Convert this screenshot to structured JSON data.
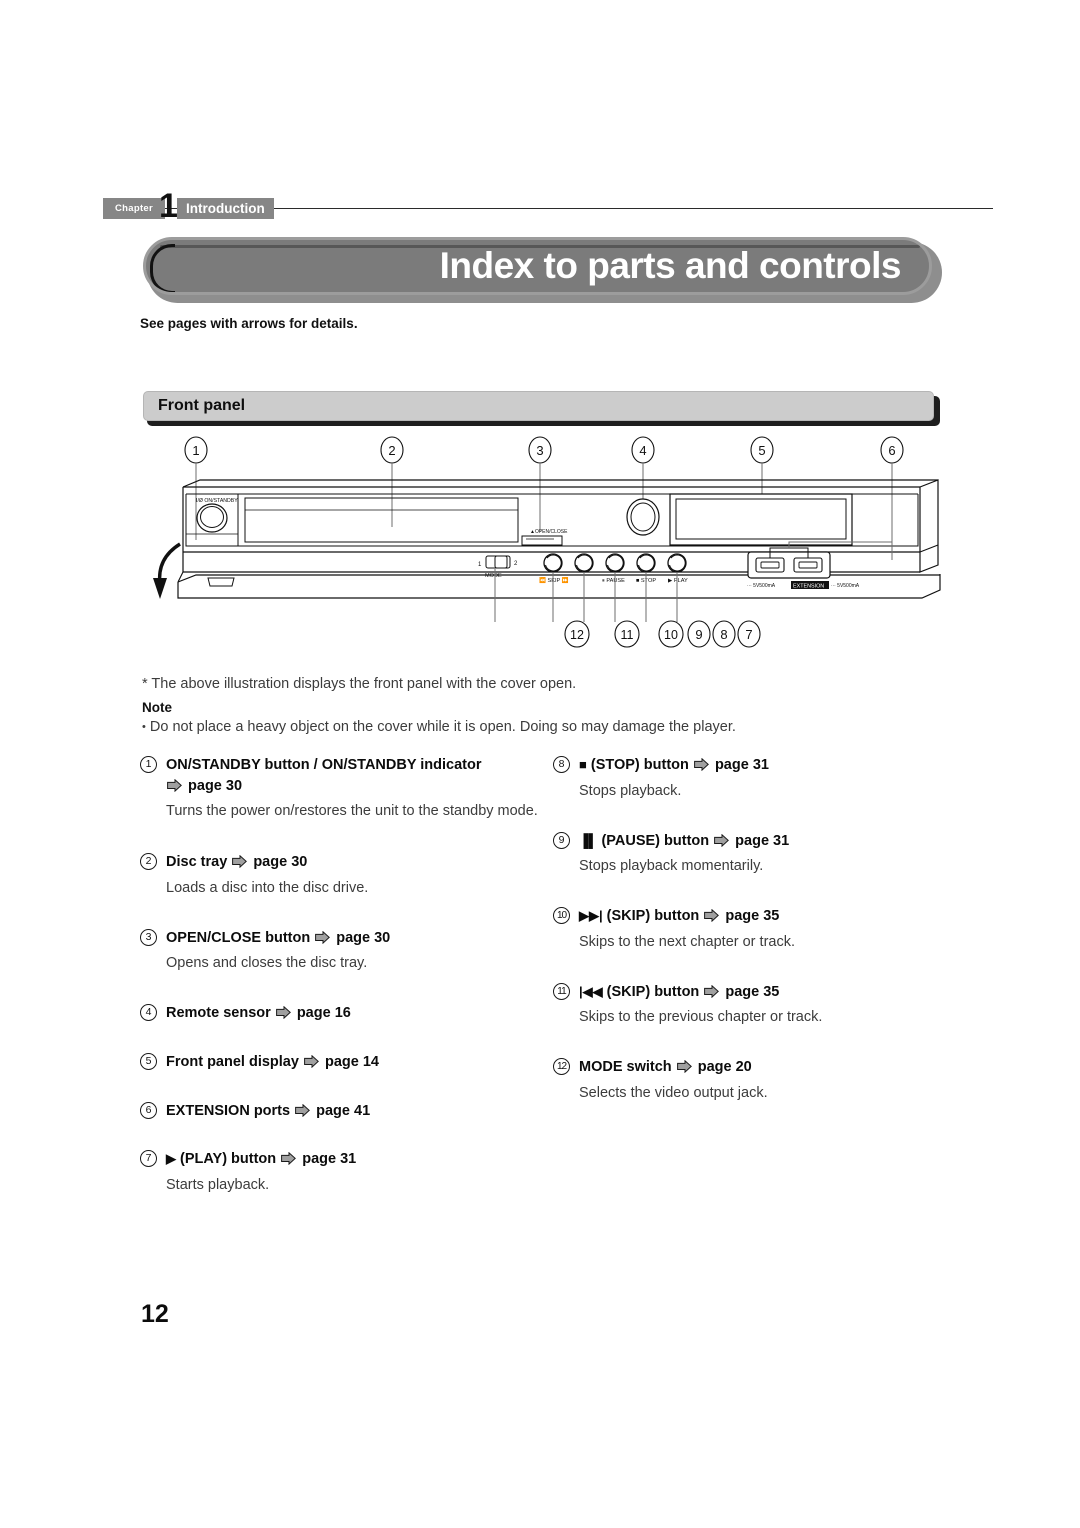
{
  "chapter": {
    "label": "Chapter",
    "number": "1",
    "title": "Introduction"
  },
  "page_title": "Index to parts and controls",
  "intro_line": "See pages with arrows for details.",
  "section": {
    "heading": "Front panel"
  },
  "illustration": {
    "callouts_top": [
      "1",
      "2",
      "3",
      "4",
      "5",
      "6"
    ],
    "callouts_bottom": [
      "12",
      "11",
      "10",
      "9",
      "8",
      "7"
    ],
    "panel_labels": {
      "standby": "I/Ø ON/STANDBY",
      "open_close": "OPEN/CLOSE",
      "mode": "MODE",
      "mode_pos_left": "1",
      "mode_pos_right": "2",
      "skip_prev": "◀◀",
      "skip_label": "SKIP",
      "skip_next": "▶▶",
      "pause": "PAUSE",
      "stop": "STOP",
      "play": "PLAY",
      "extension": "EXTENSION",
      "port_rating_left": "5V500mA",
      "port_rating_right": "5V500mA"
    }
  },
  "footnote": "* The above illustration displays the front panel with the cover open.",
  "note": {
    "heading": "Note",
    "text": "Do not place a heavy object on the cover while it is open. Doing so may damage the player."
  },
  "list": {
    "left": [
      {
        "num": "1",
        "glyph": "",
        "title": "ON/STANDBY button / ON/STANDBY indicator",
        "page": "page 30",
        "page_on_new_line": true,
        "desc": "Turns the power on/restores the unit to the standby mode."
      },
      {
        "num": "2",
        "glyph": "",
        "title": "Disc tray",
        "page": "page 30",
        "page_on_new_line": false,
        "desc": "Loads a disc into the disc drive."
      },
      {
        "num": "3",
        "glyph": "",
        "title": "OPEN/CLOSE button",
        "page": "page 30",
        "page_on_new_line": false,
        "desc": "Opens and closes the disc tray."
      },
      {
        "num": "4",
        "glyph": "",
        "title": "Remote sensor",
        "page": "page 16",
        "page_on_new_line": false,
        "desc": ""
      },
      {
        "num": "5",
        "glyph": "",
        "title": "Front panel display",
        "page": "page 14",
        "page_on_new_line": false,
        "desc": ""
      },
      {
        "num": "6",
        "glyph": "",
        "title": "EXTENSION ports",
        "page": "page 41",
        "page_on_new_line": false,
        "desc": ""
      },
      {
        "num": "7",
        "glyph": "▶",
        "title": "(PLAY) button",
        "page": "page 31",
        "page_on_new_line": false,
        "desc": "Starts playback."
      }
    ],
    "right": [
      {
        "num": "8",
        "glyph": "■",
        "title": "(STOP) button",
        "page": "page 31",
        "page_on_new_line": false,
        "desc": "Stops playback."
      },
      {
        "num": "9",
        "glyph": "▐▌",
        "title": "(PAUSE) button",
        "page": "page 31",
        "page_on_new_line": false,
        "desc": "Stops playback momentarily."
      },
      {
        "num": "10",
        "glyph": "▶▶|",
        "title": "(SKIP) button",
        "page": "page 35",
        "page_on_new_line": false,
        "desc": "Skips to the next chapter or track."
      },
      {
        "num": "11",
        "glyph": "|◀◀",
        "title": "(SKIP) button",
        "page": "page 35",
        "page_on_new_line": false,
        "desc": "Skips to the previous chapter or track."
      },
      {
        "num": "12",
        "glyph": "",
        "title": "MODE switch",
        "page": "page 20",
        "page_on_new_line": false,
        "desc": "Selects the video output jack."
      }
    ]
  },
  "page_number": "12",
  "colors": {
    "header_gray": "#868686",
    "title_pill": "#7b7b7b",
    "section_bar": "#cccccc",
    "arrow_fill": "#9a9a9a",
    "text": "#1a1a1a",
    "body_text": "#3c3c3c"
  }
}
